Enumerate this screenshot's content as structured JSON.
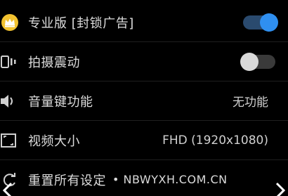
{
  "settings": {
    "rows": [
      {
        "label": "专业版 [封锁广告]",
        "icon": "crown-icon",
        "control": "toggle",
        "state": "on"
      },
      {
        "label": "拍摄震动",
        "icon": "vibrate-icon",
        "control": "toggle",
        "state": "off"
      },
      {
        "label": "音量键功能",
        "icon": "volume-icon",
        "control": "value",
        "value": "无功能"
      },
      {
        "label": "视频大小",
        "icon": "resize-icon",
        "control": "value",
        "value": "FHD (1920x1080)"
      },
      {
        "label": "重置所有设定",
        "icon": "reset-icon",
        "control": "none"
      }
    ]
  },
  "watermark": {
    "text": "NBWYXH.COM.CN"
  },
  "colors": {
    "background": "#000000",
    "accent": "#2f8ff0",
    "crown": "#f2c230"
  }
}
